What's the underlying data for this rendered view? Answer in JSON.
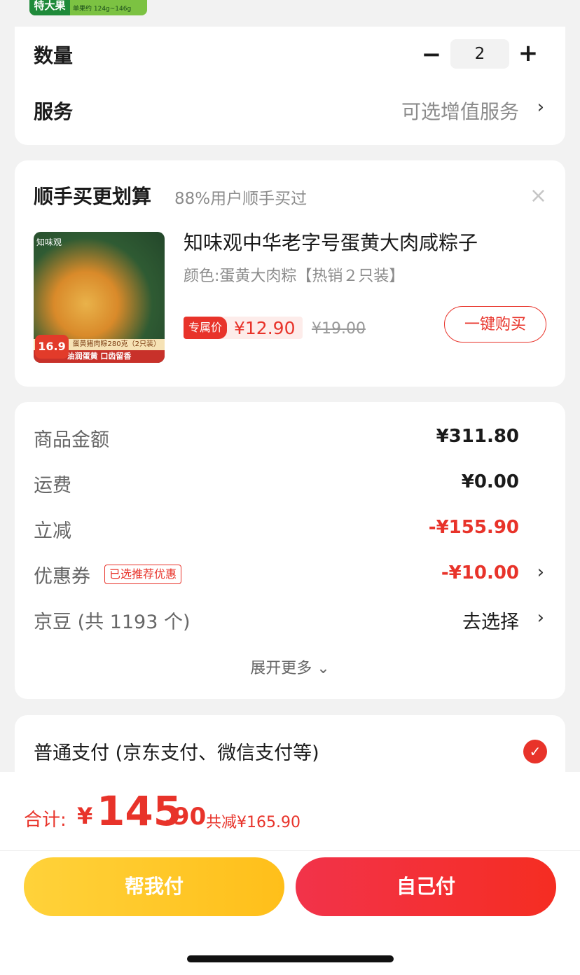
{
  "badge": {
    "main": "特大果",
    "detail": "单果约 124g~146g"
  },
  "quantity": {
    "label": "数量",
    "minus": "−",
    "value": "2",
    "plus": "+"
  },
  "service": {
    "label": "服务",
    "value": "可选增值服务",
    "chevron": "›"
  },
  "recommend": {
    "title": "顺手买更划算",
    "subtitle": "88%用户顺手买过",
    "close": "×",
    "product": {
      "image_brand": "知味观",
      "image_banner": "蛋黄猪肉粽280克（2只装）",
      "image_slogan": "油润蛋黄 口齿留香",
      "image_price": "16.9",
      "name": "知味观中华老字号蛋黄大肉咸粽子",
      "variant": "颜色:蛋黄大肉粽【热销２只装】",
      "exclusive_label": "专属价",
      "exclusive_price": "¥12.90",
      "original_price": "¥19.00",
      "buy_button": "一键购买"
    }
  },
  "fees": [
    {
      "label": "商品金额",
      "value": "¥311.80",
      "red": false
    },
    {
      "label": "运费",
      "value": "¥0.00",
      "red": false
    },
    {
      "label": "立减",
      "value": "-¥155.90",
      "red": true
    },
    {
      "label": "优惠券",
      "value": "-¥10.00",
      "red": true,
      "badge": "已选推荐优惠"
    },
    {
      "label": "京豆 (共 1193 个)",
      "value": "去选择",
      "red": false
    }
  ],
  "expand_more": "展开更多 ⌄",
  "payment": {
    "label": "普通支付 (京东支付、微信支付等)",
    "check": "✓"
  },
  "total": {
    "label": "合计:",
    "currency": "¥",
    "integer": "145",
    "decimal": ".90",
    "saved": "共减¥165.90"
  },
  "buttons": {
    "help_pay": "帮我付",
    "self_pay": "自己付"
  },
  "colors": {
    "accent_red": "#e8332a",
    "help_yellow": "#ffc926"
  }
}
